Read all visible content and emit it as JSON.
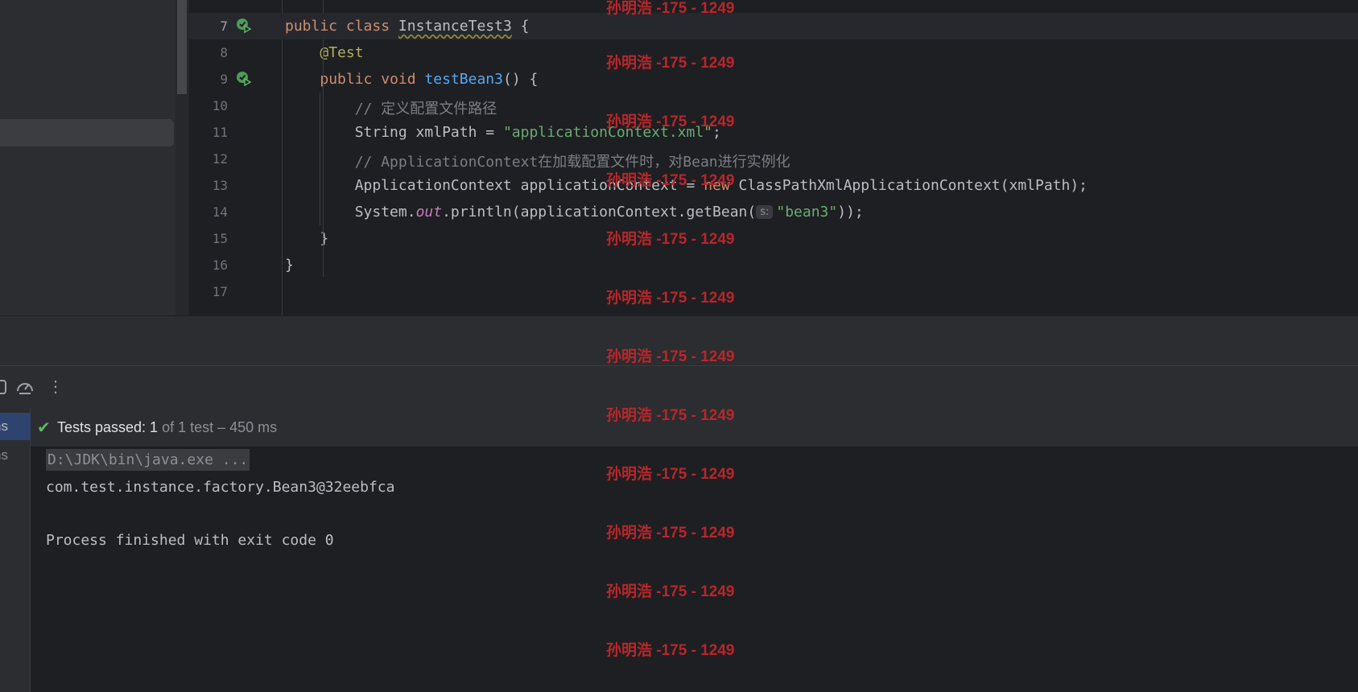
{
  "editor": {
    "lines": [
      {
        "num": "7",
        "current": true
      },
      {
        "num": "8"
      },
      {
        "num": "9"
      },
      {
        "num": "10"
      },
      {
        "num": "11"
      },
      {
        "num": "12"
      },
      {
        "num": "13"
      },
      {
        "num": "14"
      },
      {
        "num": "15"
      },
      {
        "num": "16"
      },
      {
        "num": "17"
      }
    ],
    "code": {
      "l7": {
        "kw1": "public",
        "kw2": "class",
        "cls": "InstanceTest3",
        "brace": "{"
      },
      "l8": {
        "annotation": "@Test"
      },
      "l9": {
        "kw1": "public",
        "kw2": "void",
        "method": "testBean3",
        "rest": "() {"
      },
      "l10": {
        "comment": "// 定义配置文件路径"
      },
      "l11": {
        "pre": "String xmlPath = ",
        "str": "\"applicationContext.xml\"",
        "post": ";"
      },
      "l12": {
        "comment": "// ApplicationContext在加载配置文件时，对Bean进行实例化"
      },
      "l13": {
        "pre": "ApplicationContext applicationContext = ",
        "kw": "new",
        "post": " ClassPathXmlApplicationContext(xmlPath);"
      },
      "l14": {
        "pre": "System.",
        "field": "out",
        "mid": ".println(applicationContext.getBean(",
        "hint": "s:",
        "str": "\"bean3\"",
        "post": "));"
      },
      "l15": {
        "text": "}"
      },
      "l16": {
        "text": "}"
      }
    }
  },
  "toolbar": {
    "icons": [
      "stop-icon",
      "speedometer-icon",
      "more-vertical-icon"
    ],
    "more_glyph": "⋮"
  },
  "run_tree": {
    "items": [
      {
        "label": "ns",
        "selected": true
      },
      {
        "label": "ns",
        "selected": false
      }
    ]
  },
  "status": {
    "check_glyph": "✔",
    "passed_label": "Tests passed: 1",
    "detail": " of 1 test – 450 ms"
  },
  "console": {
    "lines": [
      "D:\\JDK\\bin\\java.exe ...",
      "com.test.instance.factory.Bean3@32eebfca",
      "Process finished with exit code 0"
    ]
  },
  "watermark": {
    "text": "孙明浩 -175 - 1249"
  }
}
